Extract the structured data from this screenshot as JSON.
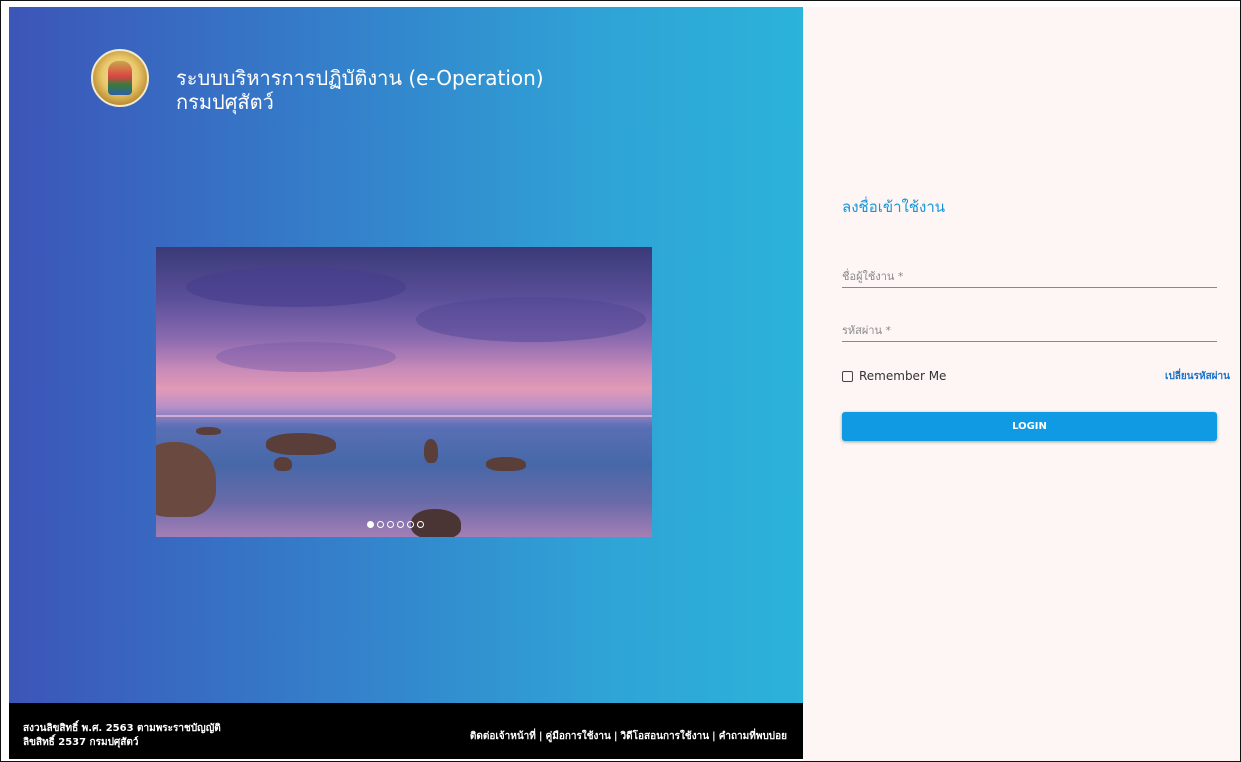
{
  "header": {
    "title_line1": "ระบบบริหารการปฏิบัติงาน (e-Operation)",
    "title_line2": "กรมปศุสัตว์"
  },
  "slider": {
    "slide_count": 6,
    "active_slide": 1
  },
  "footer": {
    "copyright_line1": "สงวนลิขสิทธิ์ พ.ศ. 2563 ตามพระราชบัญญัติ",
    "copyright_line2": "ลิขสิทธิ์ 2537 กรมปศุสัตว์",
    "link_contact": "ติดต่อเจ้าหน้าที่",
    "link_manual": "คู่มือการใช้งาน",
    "link_video": "วิดีโอสอนการใช้งาน",
    "link_faq": "คำถามที่พบบ่อย",
    "separator": "|"
  },
  "login": {
    "title": "ลงชื่อเข้าใช้งาน",
    "username_placeholder": "ชื่อผู้ใช้งาน *",
    "password_placeholder": "รหัสผ่าน *",
    "remember_label": "Remember Me",
    "change_password_link": "เปลี่ยนรหัสผ่าน",
    "login_button": "LOGIN"
  },
  "colors": {
    "accent": "#109ae4",
    "title_blue": "#1596d8",
    "gradient_start": "#3c55b8",
    "gradient_end": "#2bb3da",
    "right_bg": "#fdf6f4"
  },
  "icons": {
    "logo": "department-emblem-icon",
    "checkbox": "checkbox-unchecked-icon"
  }
}
